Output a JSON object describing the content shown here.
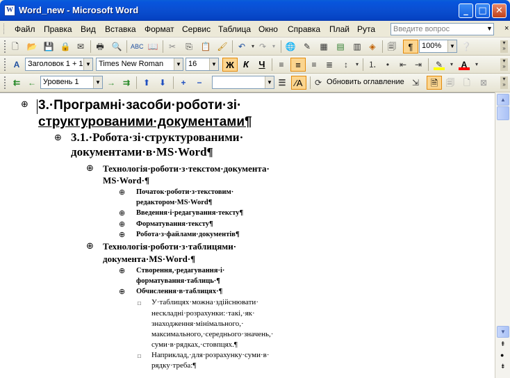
{
  "window": {
    "title": "Word_new - Microsoft Word",
    "app_icon_text": "W",
    "min_glyph": "_",
    "max_glyph": "□",
    "close_glyph": "✕"
  },
  "menu": {
    "items": [
      "Файл",
      "Правка",
      "Вид",
      "Вставка",
      "Формат",
      "Сервис",
      "Таблица",
      "Окно",
      "Справка",
      "Плай",
      "Рута"
    ],
    "help_placeholder": "Введите вопрос",
    "close_glyph": "×"
  },
  "standard_toolbar": {
    "zoom": "100%",
    "icons": [
      "new-icon",
      "open-icon",
      "save-icon",
      "permission-icon",
      "email-icon",
      "print-icon",
      "print-preview-icon",
      "spelling-icon",
      "research-icon",
      "cut-icon",
      "copy-icon",
      "paste-icon",
      "format-painter-icon",
      "undo-icon",
      "redo-icon",
      "hyperlink-icon",
      "tables-borders-icon",
      "insert-table-icon",
      "insert-excel-icon",
      "columns-icon",
      "drawing-icon",
      "document-map-icon",
      "show-formatting-icon",
      "help-icon"
    ]
  },
  "formatting_toolbar": {
    "style": "Заголовок 1 + 1",
    "font": "Times New Roman",
    "size": "16",
    "bold": "Ж",
    "italic": "К",
    "underline": "Ч",
    "highlight_color": "#ffff00",
    "font_color": "#ff0000"
  },
  "outlining_toolbar": {
    "level": "Уровень 1",
    "update_toc": "Обновить оглавление"
  },
  "document": {
    "lines": [
      {
        "text": "3.·Програмні·засоби·роботи·зі·",
        "cls": "h1"
      },
      {
        "text": "структурованими·документами¶",
        "cls": "h1"
      },
      {
        "text": "3.1.·Робота·зі·структурованими·",
        "cls": "h2"
      },
      {
        "text": "документами·в·MS·Word¶",
        "cls": "h2"
      },
      {
        "text": "Технологія·роботи·з·текстом·документа·",
        "cls": "h3"
      },
      {
        "text": "MS·Word·¶",
        "cls": "h3"
      },
      {
        "text": "Початок·роботи·з·текстовим·",
        "cls": "h4"
      },
      {
        "text": "редактором·MS·Word¶",
        "cls": "h4"
      },
      {
        "text": "Введення·і·редагування·тексту¶",
        "cls": "h4"
      },
      {
        "text": "Форматування·тексту¶",
        "cls": "h4"
      },
      {
        "text": "Робота·з·файлами·документів¶",
        "cls": "h4"
      },
      {
        "text": "Технологія·роботи·з·таблицями·",
        "cls": "h3"
      },
      {
        "text": "документа·MS·Word·¶",
        "cls": "h3"
      },
      {
        "text": "Створення,·редагування·і·",
        "cls": "h4"
      },
      {
        "text": "форматування·таблиць·¶",
        "cls": "h4"
      },
      {
        "text": "Обчислення·в·таблицях·¶",
        "cls": "h4"
      },
      {
        "text": "У·таблицях·можна·здійснювати·",
        "cls": "body"
      },
      {
        "text": "нескладні·розрахунки:·такі,·як·",
        "cls": "body"
      },
      {
        "text": "знаходження·мінімального,·",
        "cls": "body"
      },
      {
        "text": "максимального,·середнього·значень,·",
        "cls": "body"
      },
      {
        "text": "суми·в·рядках,·стовпцях.¶",
        "cls": "body"
      },
      {
        "text": "Наприклад,·для·розрахунку·суми·в·",
        "cls": "body"
      },
      {
        "text": "рядку·треба:¶",
        "cls": "body"
      }
    ]
  },
  "scrollbar": {
    "up": "▲",
    "down": "▼",
    "prev_page": "⇞",
    "browse": "●",
    "next_page": "⇟"
  }
}
